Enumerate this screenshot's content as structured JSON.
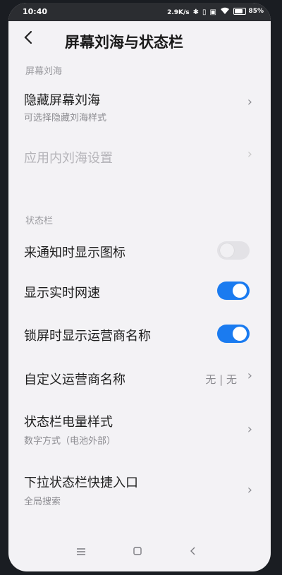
{
  "status_bar": {
    "time": "10:40",
    "net_speed": "2.9K/s",
    "battery": "85%",
    "icons": [
      "bluetooth-icon",
      "vibrate-icon",
      "nfc-icon",
      "wifi-icon",
      "battery-icon"
    ]
  },
  "header": {
    "title": "屏幕刘海与状态栏",
    "back_icon": "‹"
  },
  "sections": {
    "notch": {
      "label": "屏幕刘海"
    },
    "status_bar": {
      "label": "状态栏"
    }
  },
  "rows": {
    "hide_notch": {
      "label": "隐藏屏幕刘海",
      "sub": "可选择隐藏刘海样式"
    },
    "in_app_notch": {
      "label": "应用内刘海设置"
    },
    "notif_icons": {
      "label": "来通知时显示图标",
      "enabled": false
    },
    "net_speed": {
      "label": "显示实时网速",
      "enabled": true
    },
    "carrier_lock": {
      "label": "锁屏时显示运营商名称",
      "enabled": true
    },
    "custom_carrier": {
      "label": "自定义运营商名称",
      "value": "无 | 无"
    },
    "battery_style": {
      "label": "状态栏电量样式",
      "sub": "数字方式（电池外部）"
    },
    "pulldown": {
      "label": "下拉状态栏快捷入口",
      "sub": "全局搜索"
    }
  },
  "colors": {
    "accent": "#1a7bf0",
    "background": "#f3f2f5"
  },
  "nav": {
    "menu": "≡",
    "home": "□",
    "back": "‹"
  }
}
